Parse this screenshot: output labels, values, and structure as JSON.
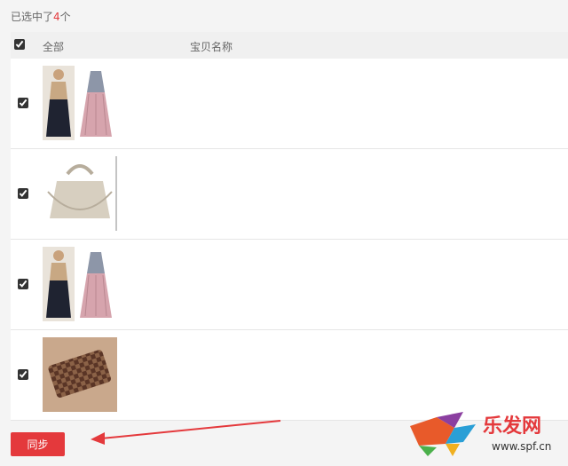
{
  "summary": {
    "prefix": "已选中了",
    "count": "4",
    "suffix": "个"
  },
  "table": {
    "col_all": "全部",
    "col_name": "宝贝名称"
  },
  "rows": [
    {
      "thumb": "dress-outfit-image",
      "checked": true
    },
    {
      "thumb": "handbag-image",
      "checked": true
    },
    {
      "thumb": "dress-outfit-image",
      "checked": true
    },
    {
      "thumb": "checkered-wallet-image",
      "checked": true
    }
  ],
  "buttons": {
    "sync": "同步"
  },
  "watermark": {
    "brand": "乐发网",
    "url": "www.spf.cn"
  }
}
